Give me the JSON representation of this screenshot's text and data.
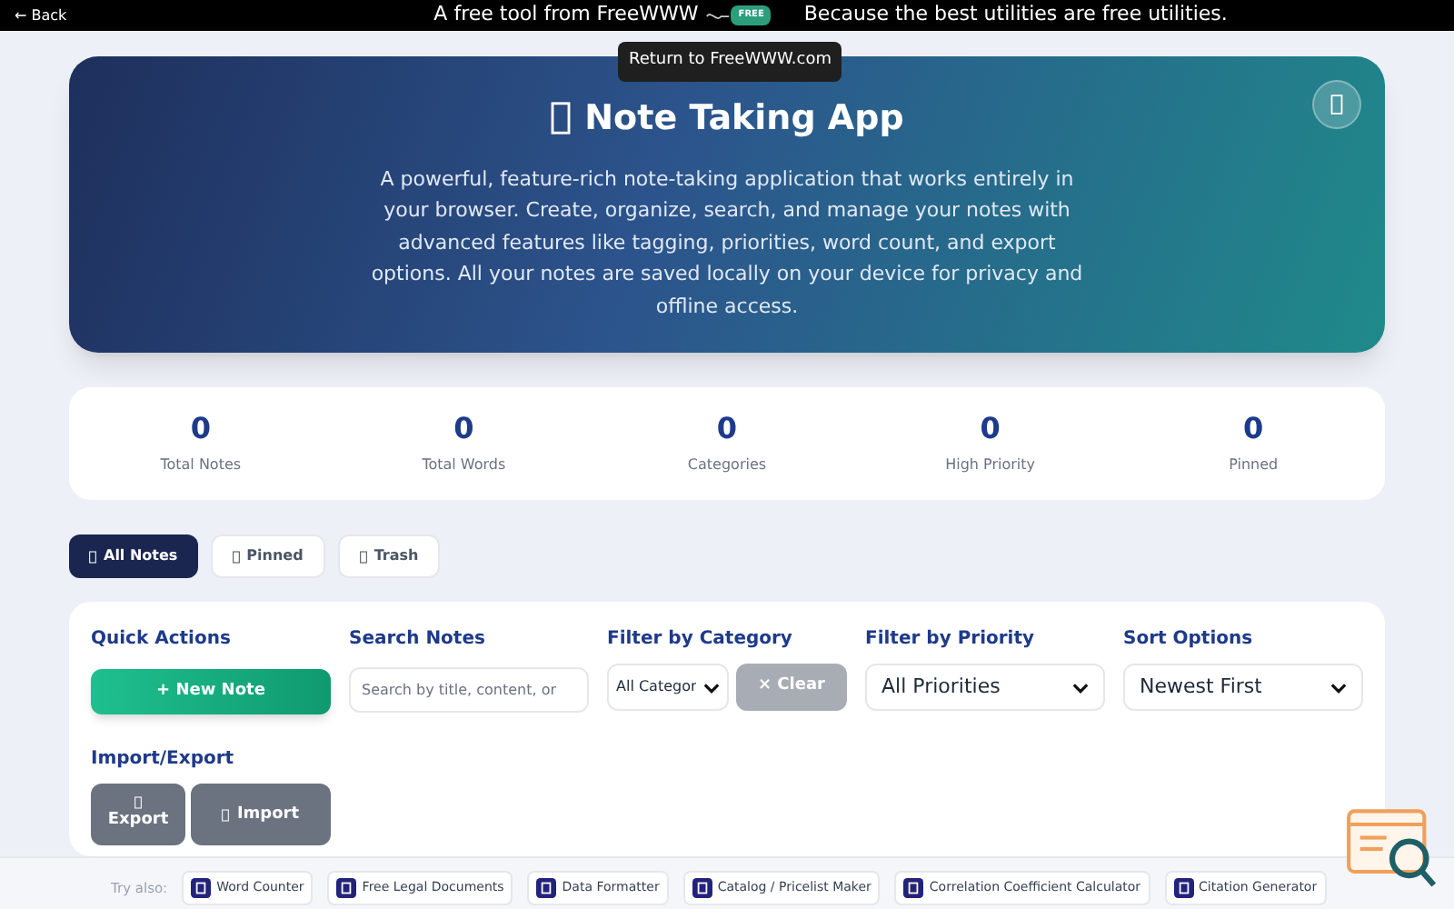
{
  "top_bar": {
    "back": "← Back",
    "tagline": "A free tool from FreeWWW",
    "badge": "FREE",
    "slogan": "Because the best utilities are free utilities.",
    "tooltip": "Return to FreeWWW.com"
  },
  "hero": {
    "title": "Note Taking App",
    "description": "A powerful, feature-rich note-taking application that works entirely in your browser. Create, organize, search, and manage your notes with advanced features like tagging, priorities, word count, and export options. All your notes are saved locally on your device for privacy and offline access."
  },
  "stats": [
    {
      "value": "0",
      "label": "Total Notes"
    },
    {
      "value": "0",
      "label": "Total Words"
    },
    {
      "value": "0",
      "label": "Categories"
    },
    {
      "value": "0",
      "label": "High Priority"
    },
    {
      "value": "0",
      "label": "Pinned"
    }
  ],
  "tabs": [
    {
      "label": "All Notes",
      "selected": true
    },
    {
      "label": "Pinned",
      "selected": false
    },
    {
      "label": "Trash",
      "selected": false
    }
  ],
  "controls": {
    "quick_actions": {
      "heading": "Quick Actions",
      "new_note": "+ New Note"
    },
    "search": {
      "heading": "Search Notes",
      "placeholder": "Search by title, content, or"
    },
    "category": {
      "heading": "Filter by Category",
      "value": "All Categor",
      "clear": "× Clear"
    },
    "priority": {
      "heading": "Filter by Priority",
      "value": "All Priorities"
    },
    "sort": {
      "heading": "Sort Options",
      "value": "Newest First"
    },
    "import_export": {
      "heading": "Import/Export",
      "export": "Export",
      "import": "Import"
    }
  },
  "try_also": {
    "label": "Try also:",
    "links": [
      "Word Counter",
      "Free Legal Documents",
      "Data Formatter",
      "Catalog / Pricelist Maker",
      "Correlation Coefficient Calculator",
      "Citation Generator"
    ]
  }
}
